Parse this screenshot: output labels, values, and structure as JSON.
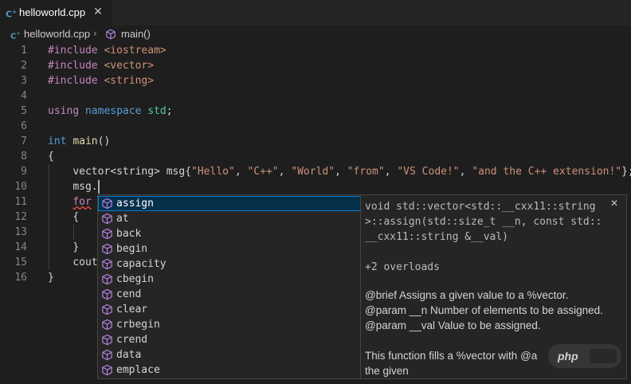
{
  "tab": {
    "label": "helloworld.cpp",
    "icon": "cpp-file-icon",
    "close": "✕"
  },
  "breadcrumb": {
    "file": "helloworld.cpp",
    "separator": "›",
    "symbol": "main()",
    "symbol_icon": "cube-method-icon"
  },
  "editor": {
    "line_numbers": [
      "1",
      "2",
      "3",
      "4",
      "5",
      "6",
      "7",
      "8",
      "9",
      "10",
      "11",
      "12",
      "13",
      "14",
      "15",
      "16"
    ]
  },
  "code": {
    "l1": {
      "directive": "#include",
      "header": "<iostream>"
    },
    "l2": {
      "directive": "#include",
      "header": "<vector>"
    },
    "l3": {
      "directive": "#include",
      "header": "<string>"
    },
    "l5": {
      "kw_using": "using",
      "kw_namespace": "namespace",
      "ns": "std",
      "end": ";"
    },
    "l7": {
      "type": "int",
      "fn": "main",
      "parens": "()"
    },
    "l8": {
      "text": "{"
    },
    "l9": {
      "indent": "    ",
      "pre": "vector<string> msg{",
      "s1": "\"Hello\"",
      "s2": "\"C++\"",
      "s3": "\"World\"",
      "s4": "\"from\"",
      "s5": "\"VS Code!\"",
      "s6": "\"and the C++ extension!\"",
      "sep": ", ",
      "end": "};"
    },
    "l10": {
      "indent": "    ",
      "text": "msg."
    },
    "l11": {
      "indent": "    ",
      "kw": "for"
    },
    "l12": {
      "indent": "    ",
      "text": "{"
    },
    "l14": {
      "indent": "    ",
      "text": "}"
    },
    "l15": {
      "indent": "    ",
      "text": "cout"
    },
    "l16": {
      "text": "}"
    }
  },
  "suggest": {
    "items": [
      {
        "label": "assign"
      },
      {
        "label": "at"
      },
      {
        "label": "back"
      },
      {
        "label": "begin"
      },
      {
        "label": "capacity"
      },
      {
        "label": "cbegin"
      },
      {
        "label": "cend"
      },
      {
        "label": "clear"
      },
      {
        "label": "crbegin"
      },
      {
        "label": "crend"
      },
      {
        "label": "data"
      },
      {
        "label": "emplace"
      }
    ],
    "selected_index": 0,
    "item_icon": "cube-method-icon"
  },
  "details": {
    "close": "✕",
    "signature": [
      "void std::vector<std::__cxx11::string",
      ">::assign(std::size_t __n, const std::",
      "__cxx11::string &__val)"
    ],
    "overloads": "+2 overloads",
    "doc": [
      "@brief Assigns a given value to a %vector.",
      "@param __n Number of elements to be assigned.",
      "@param __val Value to be assigned."
    ],
    "desc": [
      "This function fills a %vector with @a",
      "the given"
    ]
  },
  "watermark": {
    "text": "php"
  },
  "colors": {
    "editor_bg": "#1e1e1e",
    "directive": "#c586c0",
    "keyword": "#569cd6",
    "type": "#4ec9b0",
    "function": "#dcdcaa",
    "string": "#ce9178",
    "selection_border": "#007fd4"
  }
}
